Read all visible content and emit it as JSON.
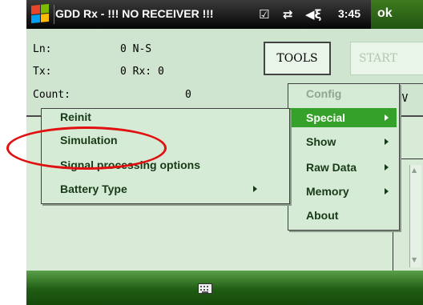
{
  "titlebar": {
    "title": "GDD Rx - !!! NO RECEIVER !!!",
    "icons": [
      "windows-flag-icon",
      "checkbox-icon",
      "connectivity-icon",
      "volume-icon"
    ],
    "time": "3:45",
    "ok_label": "ok"
  },
  "form": {
    "ln_label": "Ln:",
    "ln_value": "0 N-S",
    "tx_label": "Tx:",
    "tx_value": "0 Rx: 0",
    "count_label": "Count:",
    "count_value": "0",
    "tools_label": "TOOLS",
    "start_label": "START",
    "mv_value": "0 mV"
  },
  "tools_menu": {
    "items": [
      {
        "label": "Config",
        "enabled": false,
        "submenu": false
      },
      {
        "label": "Special",
        "enabled": true,
        "submenu": true,
        "selected": true
      },
      {
        "label": "Show",
        "enabled": true,
        "submenu": true
      },
      {
        "label": "Raw Data",
        "enabled": true,
        "submenu": true
      },
      {
        "label": "Memory",
        "enabled": true,
        "submenu": true
      },
      {
        "label": "About",
        "enabled": true,
        "submenu": false
      }
    ]
  },
  "special_menu": {
    "items": [
      {
        "label": "Reinit",
        "submenu": false
      },
      {
        "label": "Simulation",
        "submenu": false,
        "circled": true
      },
      {
        "label": "Signal processing options",
        "submenu": false
      },
      {
        "label": "Battery Type",
        "submenu": true
      }
    ]
  },
  "bottombar": {
    "icon": "keyboard-icon"
  },
  "colors": {
    "highlight": "#36a12a",
    "annotation": "#e01010",
    "background": "#cfe5cf"
  }
}
